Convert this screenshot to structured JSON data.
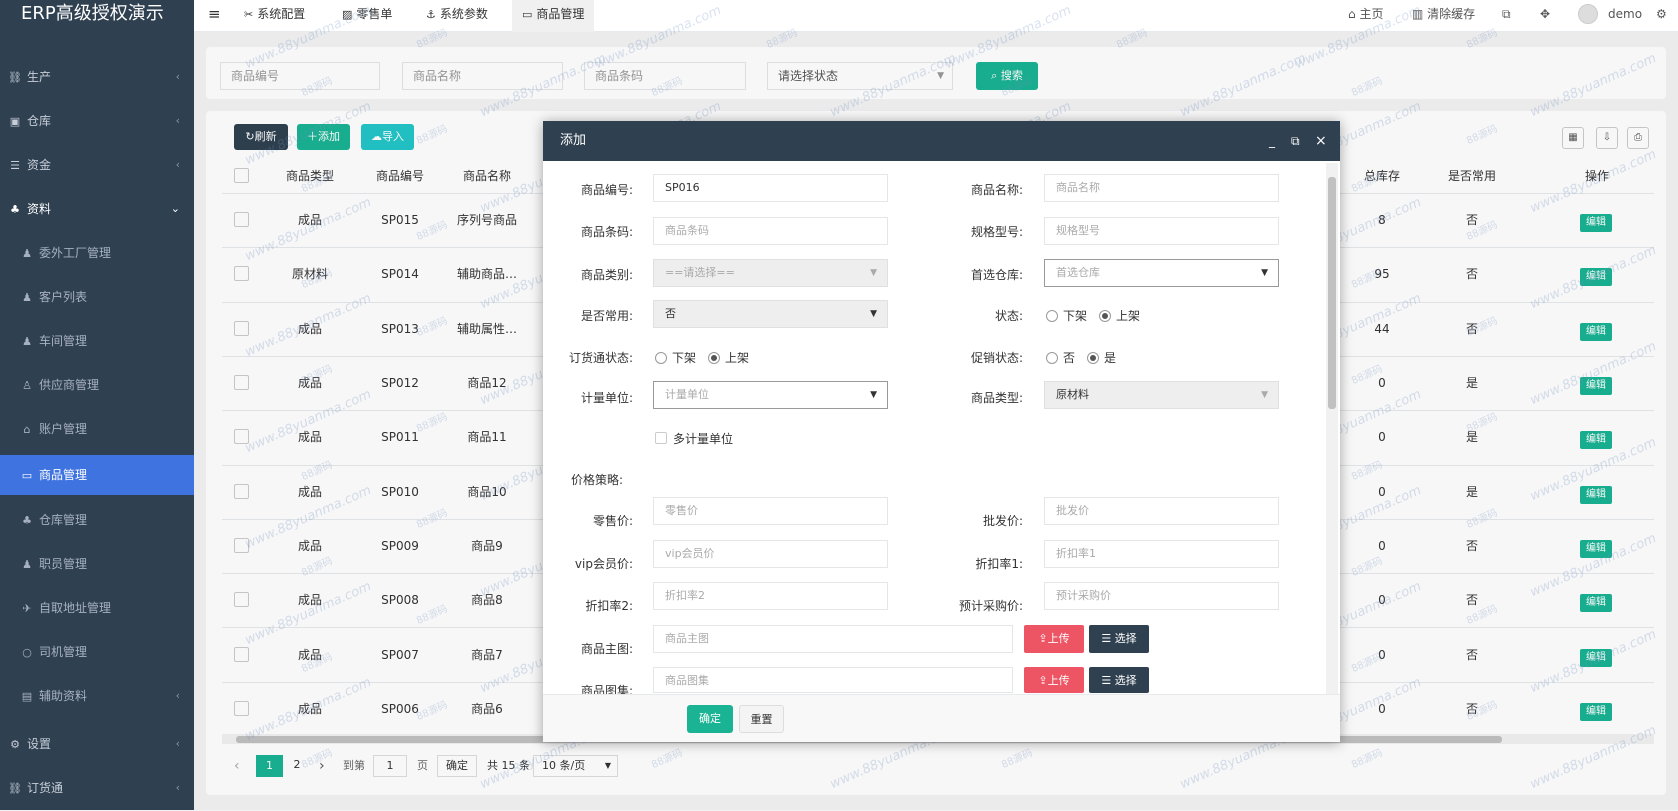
{
  "app": {
    "title": "ERP高级授权演示"
  },
  "sidebar": {
    "items": [
      {
        "label": "生产",
        "icon": "network-icon",
        "type": "parent"
      },
      {
        "label": "仓库",
        "icon": "warehouse-icon",
        "type": "parent"
      },
      {
        "label": "资金",
        "icon": "database-icon",
        "type": "parent"
      },
      {
        "label": "资料",
        "icon": "cubes-icon",
        "type": "parent-open"
      },
      {
        "label": "委外工厂管理",
        "icon": "user-plus-icon",
        "type": "sub"
      },
      {
        "label": "客户列表",
        "icon": "user-plus-icon",
        "type": "sub"
      },
      {
        "label": "车间管理",
        "icon": "user-plus-icon",
        "type": "sub"
      },
      {
        "label": "供应商管理",
        "icon": "user-tie-icon",
        "type": "sub"
      },
      {
        "label": "账户管理",
        "icon": "bank-icon",
        "type": "sub"
      },
      {
        "label": "商品管理",
        "icon": "book-icon",
        "type": "sub-active"
      },
      {
        "label": "仓库管理",
        "icon": "cubes-icon",
        "type": "sub"
      },
      {
        "label": "职员管理",
        "icon": "user-icon",
        "type": "sub"
      },
      {
        "label": "自取地址管理",
        "icon": "bird-icon",
        "type": "sub"
      },
      {
        "label": "司机管理",
        "icon": "circle-icon",
        "type": "sub"
      },
      {
        "label": "辅助资料",
        "icon": "trash-icon",
        "type": "sub-parent"
      },
      {
        "label": "设置",
        "icon": "gears-icon",
        "type": "parent"
      },
      {
        "label": "订货通",
        "icon": "network-icon",
        "type": "parent"
      }
    ]
  },
  "topbar": {
    "menu_icon": "≡",
    "tabs": [
      {
        "label": "系统配置",
        "icon": "wrench-icon"
      },
      {
        "label": "零售单",
        "icon": "image-icon"
      },
      {
        "label": "系统参数",
        "icon": "anchor-icon"
      },
      {
        "label": "商品管理",
        "icon": "book-icon"
      }
    ],
    "home": "主页",
    "clear_cache": "清除缓存",
    "user": "demo"
  },
  "search": {
    "code_placeholder": "商品编号",
    "name_placeholder": "商品名称",
    "barcode_placeholder": "商品条码",
    "status_placeholder": "请选择状态",
    "button": "搜索"
  },
  "toolbar": {
    "refresh": "刷新",
    "add": "添加",
    "import": "导入"
  },
  "table": {
    "headers": [
      "商品类型",
      "商品编号",
      "商品名称",
      "总库存",
      "是否常用",
      "操作"
    ],
    "edit_label": "编辑",
    "rows": [
      {
        "type": "成品",
        "code": "SP015",
        "name": "序列号商品",
        "stock": "8",
        "common": "否"
      },
      {
        "type": "原材料",
        "code": "SP014",
        "name": "辅助商品…",
        "stock": "95",
        "common": "否"
      },
      {
        "type": "成品",
        "code": "SP013",
        "name": "辅助属性…",
        "stock": "44",
        "common": "否"
      },
      {
        "type": "成品",
        "code": "SP012",
        "name": "商品12",
        "stock": "0",
        "common": "是"
      },
      {
        "type": "成品",
        "code": "SP011",
        "name": "商品11",
        "stock": "0",
        "common": "是"
      },
      {
        "type": "成品",
        "code": "SP010",
        "name": "商品10",
        "stock": "0",
        "common": "是"
      },
      {
        "type": "成品",
        "code": "SP009",
        "name": "商品9",
        "stock": "0",
        "common": "否"
      },
      {
        "type": "成品",
        "code": "SP008",
        "name": "商品8",
        "stock": "0",
        "common": "否"
      },
      {
        "type": "成品",
        "code": "SP007",
        "name": "商品7",
        "stock": "0",
        "common": "否"
      },
      {
        "type": "成品",
        "code": "SP006",
        "name": "商品6",
        "stock": "0",
        "common": "否"
      }
    ]
  },
  "pagination": {
    "page1": "1",
    "page2": "2",
    "goto": "到第",
    "goto_value": "1",
    "page_unit": "页",
    "confirm": "确定",
    "total": "共 15 条",
    "page_size": "10 条/页"
  },
  "modal": {
    "title": "添加",
    "fields": {
      "code_label": "商品编号:",
      "code_value": "SP016",
      "name_label": "商品名称:",
      "name_placeholder": "商品名称",
      "barcode_label": "商品条码:",
      "barcode_placeholder": "商品条码",
      "spec_label": "规格型号:",
      "spec_placeholder": "规格型号",
      "category_label": "商品类别:",
      "category_placeholder": "==请选择==",
      "warehouse_label": "首选仓库:",
      "warehouse_placeholder": "首选仓库",
      "common_label": "是否常用:",
      "common_value": "否",
      "status_label": "状态:",
      "status_off": "下架",
      "status_on": "上架",
      "order_status_label": "订货通状态:",
      "order_off": "下架",
      "order_on": "上架",
      "promo_label": "促销状态:",
      "promo_no": "否",
      "promo_yes": "是",
      "unit_label": "计量单位:",
      "unit_placeholder": "计量单位",
      "goods_type_label": "商品类型:",
      "goods_type_value": "原材料",
      "multi_unit": "多计量单位",
      "price_strategy": "价格策略:",
      "retail_label": "零售价:",
      "retail_placeholder": "零售价",
      "wholesale_label": "批发价:",
      "wholesale_placeholder": "批发价",
      "vip_label": "vip会员价:",
      "vip_placeholder": "vip会员价",
      "discount1_label": "折扣率1:",
      "discount1_placeholder": "折扣率1",
      "discount2_label": "折扣率2:",
      "discount2_placeholder": "折扣率2",
      "purchase_label": "预计采购价:",
      "purchase_placeholder": "预计采购价",
      "main_img_label": "商品主图:",
      "main_img_placeholder": "商品主图",
      "gallery_label": "商品图集:",
      "gallery_placeholder": "商品图集",
      "upload": "上传",
      "choose": "选择"
    },
    "confirm": "确定",
    "reset": "重置"
  },
  "watermark": {
    "domain": "www.88yuanma.com",
    "brand": "88源码"
  },
  "colors": {
    "sidebar": "#2f4050",
    "active": "#3f73e0",
    "primary": "#1ab394",
    "danger": "#ed5565",
    "dark": "#2f4050",
    "info": "#23c6c8"
  }
}
